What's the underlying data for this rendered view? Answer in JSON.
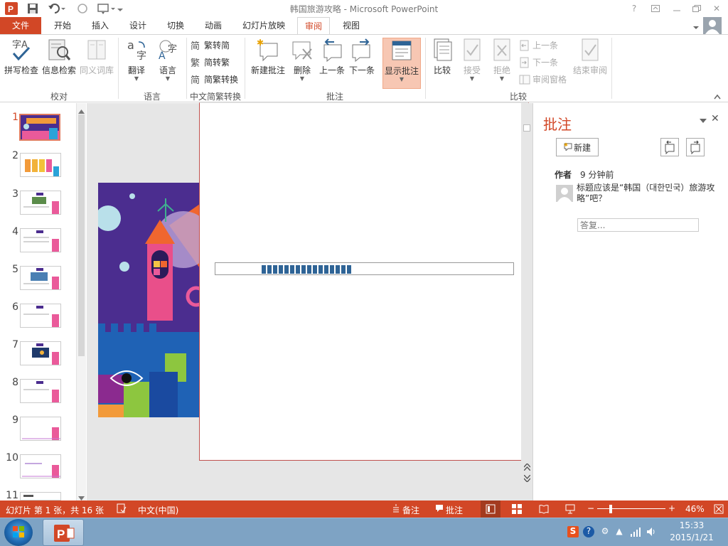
{
  "window": {
    "title": "韩国旅游攻略 - Microsoft PowerPoint"
  },
  "tabs": [
    "文件",
    "开始",
    "插入",
    "设计",
    "切换",
    "动画",
    "幻灯片放映",
    "审阅",
    "视图"
  ],
  "ribbon": {
    "proofing": {
      "spell": "拼写检查",
      "research": "信息检索",
      "thesaurus": "同义词库",
      "group": "校对"
    },
    "language": {
      "translate": "翻译",
      "language": "语言",
      "group": "语言"
    },
    "chinese": {
      "to_simplified": "繁转简",
      "to_traditional": "简转繁",
      "convert": "简繁转换",
      "group": "中文简繁转换"
    },
    "comments": {
      "new": "新建批注",
      "delete": "删除",
      "previous": "上一条",
      "next": "下一条",
      "show": "显示批注",
      "group": "批注"
    },
    "compare": {
      "compare": "比较",
      "accept": "接受",
      "reject": "拒绝",
      "prev": "上一条",
      "next": "下一条",
      "pane": "审阅窗格",
      "end": "结束审阅",
      "group": "比较"
    }
  },
  "thumbnails": [
    "1",
    "2",
    "3",
    "4",
    "5",
    "6",
    "7",
    "8",
    "9",
    "10",
    "11"
  ],
  "progress": 0.31,
  "comments_pane": {
    "title": "批注",
    "new_button": "新建",
    "author": "作者",
    "time": "9 分钟前",
    "text": "标题应该是“韩国（대한민국）旅游攻略”吧？",
    "reply_placeholder": "答复..."
  },
  "status": {
    "slide_info": "幻灯片 第 1 张，共 16 张",
    "language": "中文(中国)",
    "notes": "备注",
    "comments": "批注",
    "zoom": "46%"
  },
  "taskbar": {
    "time": "15:33",
    "date": "2015/1/21"
  },
  "colors": {
    "accent": "#d24726",
    "progress": "#2f6496",
    "slide_bg": "#4b2d8f"
  }
}
